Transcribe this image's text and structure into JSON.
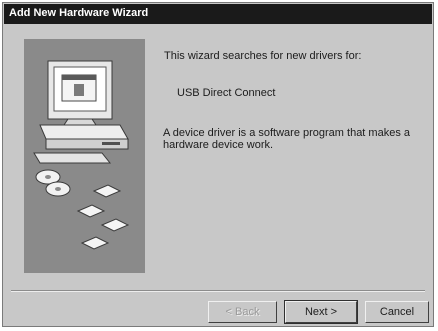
{
  "window": {
    "title": "Add New Hardware Wizard"
  },
  "content": {
    "intro": "This wizard searches for new drivers for:",
    "device_name": "USB Direct Connect",
    "description_line1": "A device driver is a software program that makes a",
    "description_line2": "hardware device work."
  },
  "buttons": {
    "back": "< Back",
    "next": "Next >",
    "cancel": "Cancel"
  }
}
